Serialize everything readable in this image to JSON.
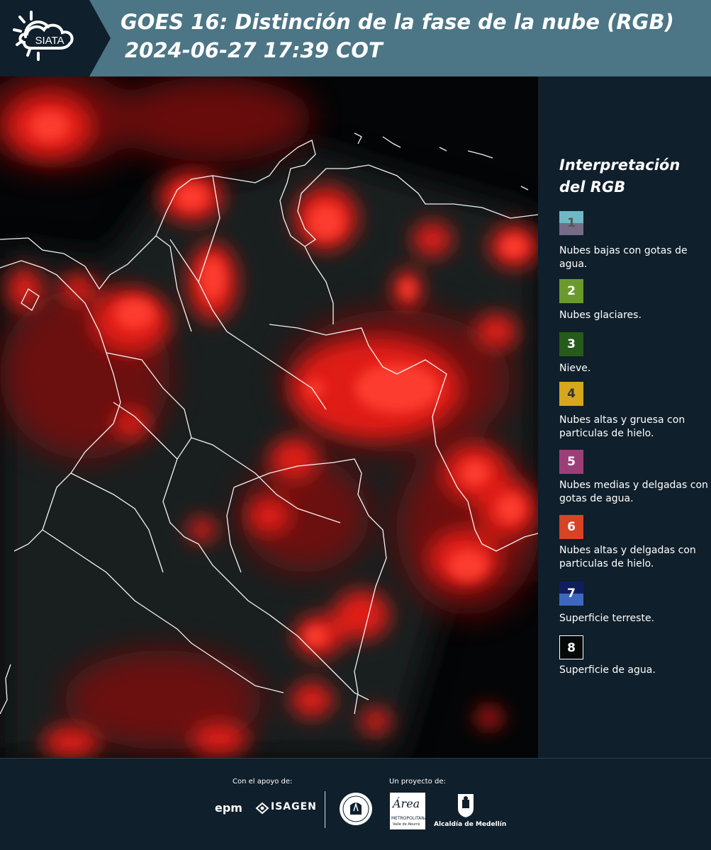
{
  "header": {
    "logo_text": "SIATA",
    "title": "GOES 16: Distinción de la fase de la nube (RGB)",
    "datetime": "2024-06-27 17:39 COT"
  },
  "legend": {
    "title": "Interpretación del RGB",
    "items": [
      {
        "number": "1",
        "label": "Nubes bajas con gotas de agua.",
        "color_top": "#6fb9c6",
        "color_bottom": "#756c88"
      },
      {
        "number": "2",
        "label": "Nubes glaciares.",
        "color": "#6a9a2c"
      },
      {
        "number": "3",
        "label": "Nieve.",
        "color": "#275b1b"
      },
      {
        "number": "4",
        "label": "Nubes altas y gruesa con particulas de hielo.",
        "color": "#d6a61c"
      },
      {
        "number": "5",
        "label": "Nubes medias y delgadas con gotas de agua.",
        "color": "#9c3f78"
      },
      {
        "number": "6",
        "label": "Nubes altas y delgadas con particulas de hielo.",
        "color": "#d84326"
      },
      {
        "number": "7",
        "label": "Superficie terreste.",
        "color_top": "#101e5e",
        "color_bottom": "#3e67bf"
      },
      {
        "number": "8",
        "label": "Superficie de agua.",
        "color": "#050a08"
      }
    ]
  },
  "footer": {
    "support_label": "Con el apoyo de:",
    "project_label": "Un proyecto de:",
    "sponsors": [
      "epm",
      "ISAGEN"
    ],
    "partners": [
      "Área Metropolitana Valle de Aburrá",
      "Alcaldía de Medellín"
    ],
    "amva_word": "Área",
    "amva_sub1": "METROPOLITANA",
    "amva_sub2": "Valle de Aburrá",
    "alcaldia_label": "Alcaldía de Medellín"
  }
}
